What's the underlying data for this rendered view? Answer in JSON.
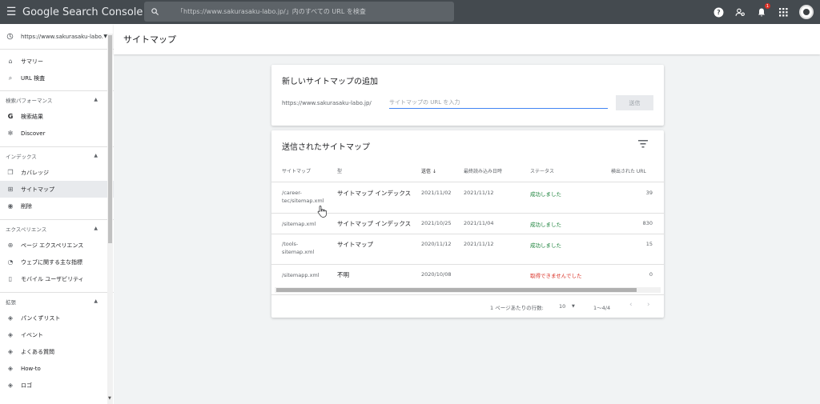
{
  "topbar": {
    "app_title": "Google Search Console",
    "search_placeholder": "「https://www.sakurasaku-labo.jp/」内のすべての URL を検査",
    "notification_count": "1"
  },
  "sidebar": {
    "property": "https://www.sakurasaku-labo...",
    "top_items": [
      {
        "label": "サマリー",
        "icon": "home-icon"
      },
      {
        "label": "URL 検査",
        "icon": "search-icon"
      }
    ],
    "sections": [
      {
        "title": "検索パフォーマンス",
        "items": [
          {
            "label": "検索結果",
            "icon": "google-icon"
          },
          {
            "label": "Discover",
            "icon": "asterisk-icon"
          }
        ]
      },
      {
        "title": "インデックス",
        "items": [
          {
            "label": "カバレッジ",
            "icon": "file-copy-icon"
          },
          {
            "label": "サイトマップ",
            "icon": "sitemap-icon",
            "active": true
          },
          {
            "label": "削除",
            "icon": "eye-off-icon"
          }
        ]
      },
      {
        "title": "エクスペリエンス",
        "items": [
          {
            "label": "ページ エクスペリエンス",
            "icon": "plus-circle-icon"
          },
          {
            "label": "ウェブに関する主な指標",
            "icon": "gauge-icon"
          },
          {
            "label": "モバイル ユーザビリティ",
            "icon": "phone-icon"
          }
        ]
      },
      {
        "title": "拡張",
        "items": [
          {
            "label": "パンくずリスト",
            "icon": "layers-icon"
          },
          {
            "label": "イベント",
            "icon": "layers-icon"
          },
          {
            "label": "よくある質問",
            "icon": "layers-icon"
          },
          {
            "label": "How-to",
            "icon": "layers-icon"
          },
          {
            "label": "ロゴ",
            "icon": "layers-icon"
          }
        ]
      }
    ]
  },
  "page_title": "サイトマップ",
  "add_sitemap": {
    "title": "新しいサイトマップの追加",
    "url_prefix": "https://www.sakurasaku-labo.jp/",
    "input_placeholder": "サイトマップの URL を入力",
    "submit_label": "送信"
  },
  "submitted": {
    "title": "送信されたサイトマップ",
    "columns": [
      "サイトマップ",
      "型",
      "送信 ↓",
      "最終読み込み日時",
      "ステータス",
      "検出された URL"
    ],
    "rows": [
      {
        "path": "/career-tec/sitemap.xml",
        "type": "サイトマップ インデックス",
        "submitted": "2021/11/02",
        "last_read": "2021/11/12",
        "status": "成功しました",
        "status_kind": "ok",
        "urls": "39"
      },
      {
        "path": "/sitemap.xml",
        "type": "サイトマップ インデックス",
        "submitted": "2021/10/25",
        "last_read": "2021/11/04",
        "status": "成功しました",
        "status_kind": "ok",
        "urls": "830"
      },
      {
        "path": "/tools-sitemap.xml",
        "type": "サイトマップ",
        "submitted": "2020/11/12",
        "last_read": "2021/11/12",
        "status": "成功しました",
        "status_kind": "ok",
        "urls": "15"
      },
      {
        "path": "/sitemapp.xml",
        "type": "不明",
        "submitted": "2020/10/08",
        "last_read": "",
        "status": "取得できませんでした",
        "status_kind": "err",
        "urls": "0"
      }
    ],
    "pager": {
      "rows_per_page_label": "1 ページあたりの行数:",
      "rows_per_page": "10",
      "range": "1〜4/4"
    }
  },
  "colors": {
    "topbar": "#444a4f",
    "success": "#188038",
    "error": "#d93025",
    "accent": "#4285f4"
  }
}
